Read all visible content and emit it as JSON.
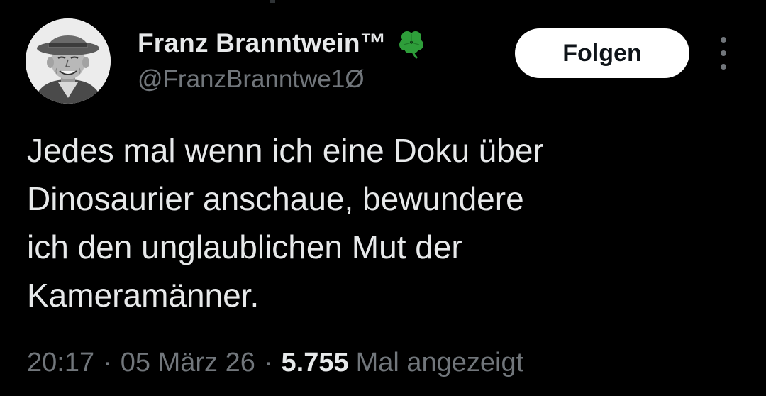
{
  "user": {
    "display_name": "Franz Branntwein™",
    "handle": "@FranzBranntwe1Ø",
    "badge_icon": "four-leaf-clover",
    "avatar": "portrait-of-man-with-hat"
  },
  "actions": {
    "follow_label": "Folgen",
    "more_icon": "vertical-ellipsis"
  },
  "tweet": {
    "lines": [
      "Jedes mal wenn ich eine Doku über",
      "Dinosaurier anschaue, bewundere",
      "ich den unglaublichen Mut der",
      "Kameramänner."
    ]
  },
  "meta": {
    "time": "20:17",
    "separator": "·",
    "date": "05 März 26",
    "views_count": "5.755",
    "views_label": "Mal angezeigt"
  },
  "colors": {
    "background": "#000000",
    "text_primary": "#e7e9ea",
    "text_secondary": "#71767b",
    "button_bg": "#ffffff",
    "button_text": "#0f1419",
    "clover": "#2e9e3a"
  }
}
